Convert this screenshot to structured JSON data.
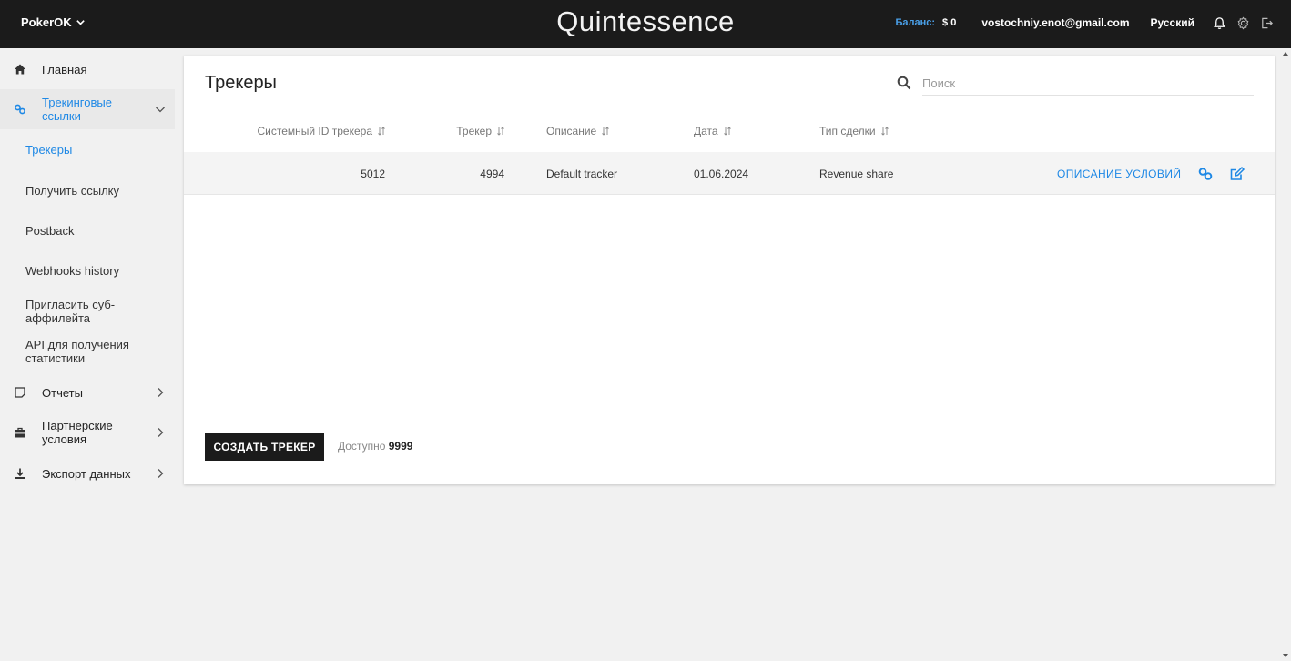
{
  "header": {
    "brand": "PokerOK",
    "logo": "Quintessence",
    "balance_label": "Баланс:",
    "balance_value": "$ 0",
    "email": "vostochniy.enot@gmail.com",
    "language": "Русский",
    "icons": [
      "bell-icon",
      "gear-icon",
      "logout-icon"
    ]
  },
  "sidebar": {
    "home": "Главная",
    "tracking": "Трекинговые ссылки",
    "sub_items": [
      "Трекеры",
      "Получить ссылку",
      "Postback",
      "Webhooks history",
      "Пригласить суб-аффилейта",
      "API для получения статистики"
    ],
    "reports": "Отчеты",
    "partner_terms": "Партнерские условия",
    "export": "Экспорт данных"
  },
  "main": {
    "title": "Трекеры",
    "search_placeholder": "Поиск",
    "columns": [
      "Системный ID трекера",
      "Трекер",
      "Описание",
      "Дата",
      "Тип сделки"
    ],
    "rows": [
      {
        "system_id": "5012",
        "tracker": "4994",
        "description": "Default tracker",
        "date": "01.06.2024",
        "deal_type": "Revenue share",
        "action": "ОПИСАНИЕ УСЛОВИЙ"
      }
    ],
    "create_button": "СОЗДАТЬ ТРЕКЕР",
    "available_label": "Доступно",
    "available_count": "9999"
  },
  "colors": {
    "topbar": "#1b1b1b",
    "accent": "#1e88e5",
    "background": "#f1f1f1"
  }
}
